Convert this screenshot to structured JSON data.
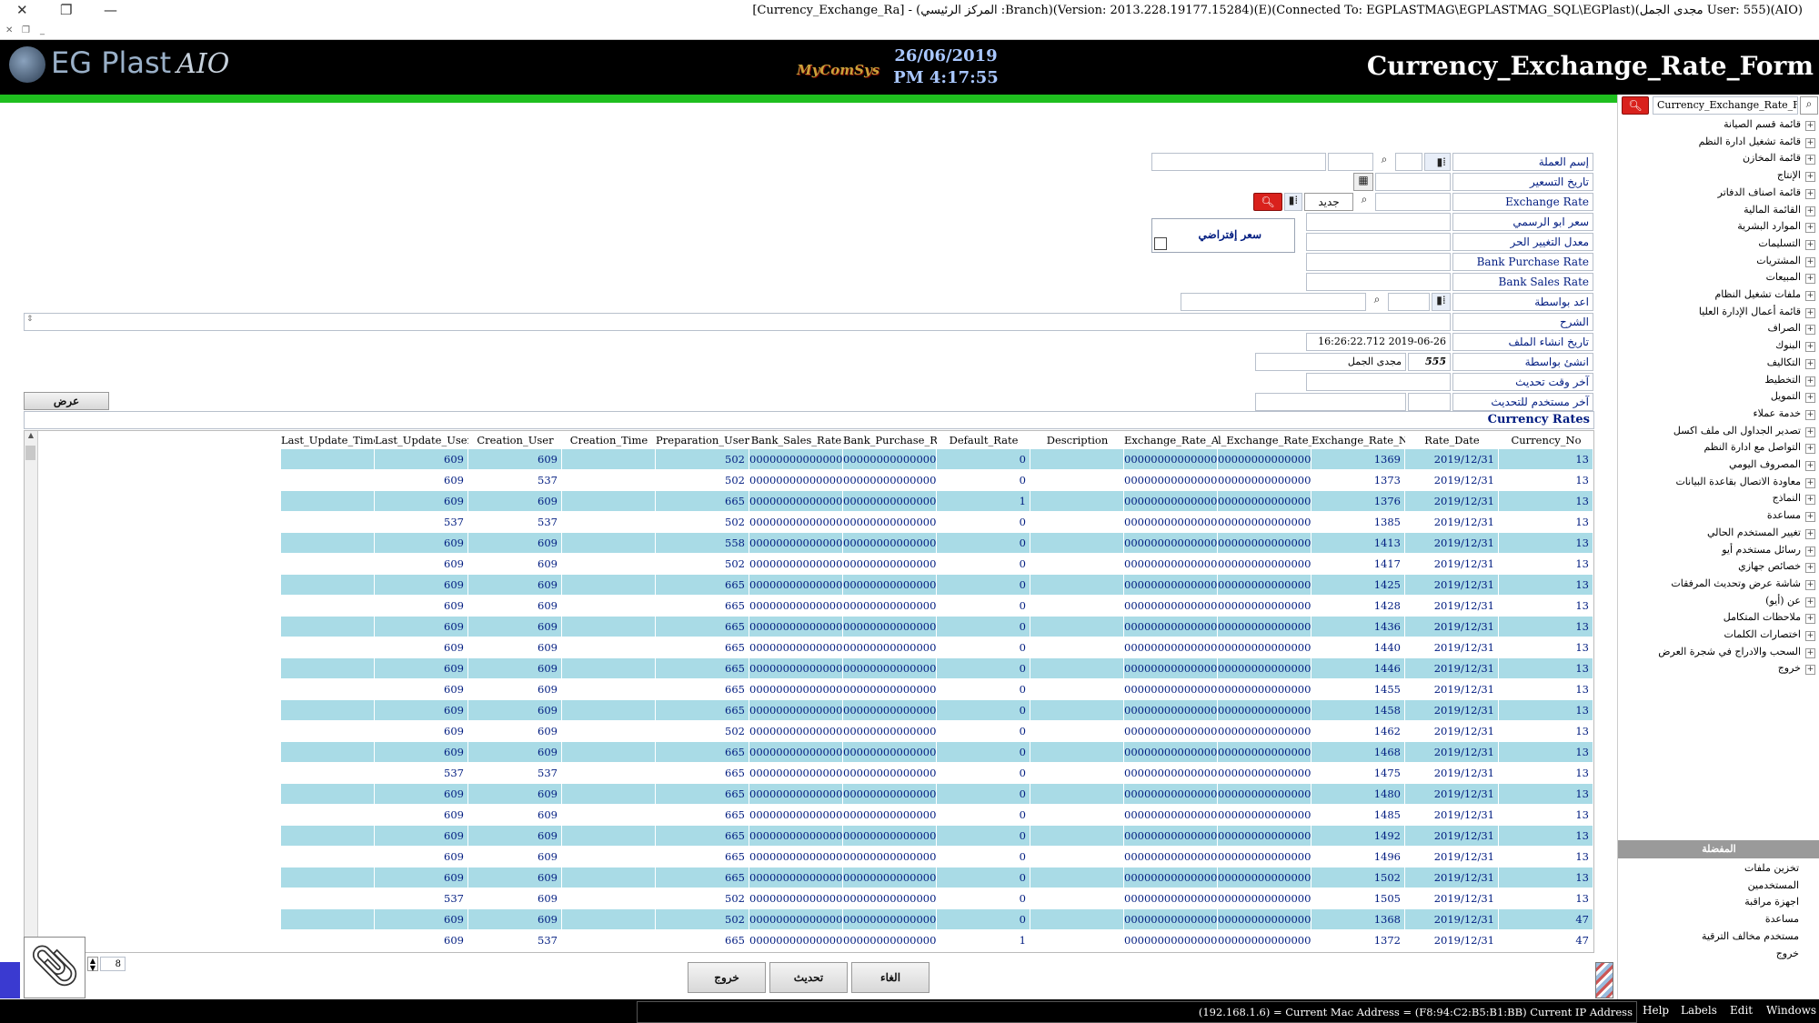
{
  "window": {
    "title": "[Currency_Exchange_Ra] - (المركز الرئيسي :Branch)(Version: 2013.228.19177.15284)(E)(Connected To: EGPLASTMAG\\EGPLASTMAG_SQL\\EGPlast)(مجدى الجمل User: 555)(AIO)"
  },
  "header": {
    "brand": "EG Plast",
    "brand_suffix": "AIO",
    "mycomsys": "MyComSys",
    "date": "26/06/2019",
    "time": "PM 4:17:55",
    "form_title": "Currency_Exchange_Rate_Form"
  },
  "form": {
    "labels": {
      "currency_name": "إسم العملة",
      "price_date": "تاريخ التسعير",
      "exchange_rate": "Exchange Rate",
      "official_price": "سعر ابو الرسمي",
      "free_rate": "معدل التغيير الحر",
      "bank_purchase_rate": "Bank Purchase Rate",
      "bank_sales_rate": "Bank Sales Rate",
      "prepared_by": "اعد بواسطة",
      "description": "الشرح",
      "creation_date": "تاريخ انشاء الملف",
      "created_by": "انشئ بواسطة",
      "last_update_time": "آخر وقت تحديث",
      "last_update_user": "آخر مستخدم للتحديث"
    },
    "new_label": "جديد",
    "default_price_label": "سعر إفتراضي",
    "creation_date_value": "16:26:22.712 2019-06-26",
    "created_by_code": "555",
    "created_by_name": "مجدى الجمل",
    "show_button": "عرض",
    "section_title": "Currency Rates"
  },
  "grid": {
    "columns": [
      "Currency_No",
      "Rate_Date",
      "Exchange_Rate_No",
      "l_Exchange_Rate_A",
      "Exchange_Rate_Am",
      "Description",
      "Default_Rate",
      "Bank_Purchase_Rate",
      "Bank_Sales_Rate",
      "Preparation_User",
      "Creation_Time",
      "Creation_User",
      "Last_Update_User",
      "Last_Update_Time"
    ],
    "rows": [
      [
        "13",
        "2019/12/31",
        "1369",
        "0000000000000000",
        "0000000000000000",
        "",
        "0",
        "0000000000000000",
        "0000000000000000",
        "502",
        "",
        "609",
        "609",
        ""
      ],
      [
        "13",
        "2019/12/31",
        "1373",
        "0000000000000000",
        "0000000000000000",
        "",
        "0",
        "0000000000000000",
        "0000000000000000",
        "502",
        "",
        "537",
        "609",
        ""
      ],
      [
        "13",
        "2019/12/31",
        "1376",
        "0000000000000000",
        "0000000000000000",
        "",
        "1",
        "0000000000000000",
        "0000000000000000",
        "665",
        "",
        "609",
        "609",
        ""
      ],
      [
        "13",
        "2019/12/31",
        "1385",
        "0000000000000000",
        "0000000000000000",
        "",
        "0",
        "0000000000000000",
        "0000000000000000",
        "502",
        "",
        "537",
        "537",
        ""
      ],
      [
        "13",
        "2019/12/31",
        "1413",
        "0000000000000000",
        "0000000000000000",
        "",
        "0",
        "0000000000000000",
        "0000000000000000",
        "558",
        "",
        "609",
        "609",
        ""
      ],
      [
        "13",
        "2019/12/31",
        "1417",
        "0000000000000000",
        "0000000000000000",
        "",
        "0",
        "0000000000000000",
        "0000000000000000",
        "502",
        "",
        "609",
        "609",
        ""
      ],
      [
        "13",
        "2019/12/31",
        "1425",
        "0000000000000000",
        "0000000000000000",
        "",
        "0",
        "0000000000000000",
        "0000000000000000",
        "665",
        "",
        "609",
        "609",
        ""
      ],
      [
        "13",
        "2019/12/31",
        "1428",
        "0000000000000000",
        "0000000000000000",
        "",
        "0",
        "0000000000000000",
        "0000000000000000",
        "665",
        "",
        "609",
        "609",
        ""
      ],
      [
        "13",
        "2019/12/31",
        "1436",
        "0000000000000000",
        "0000000000000000",
        "",
        "0",
        "0000000000000000",
        "0000000000000000",
        "665",
        "",
        "609",
        "609",
        ""
      ],
      [
        "13",
        "2019/12/31",
        "1440",
        "0000000000000000",
        "0000000000000000",
        "",
        "0",
        "0000000000000000",
        "0000000000000000",
        "665",
        "",
        "609",
        "609",
        ""
      ],
      [
        "13",
        "2019/12/31",
        "1446",
        "0000000000000000",
        "0000000000000000",
        "",
        "0",
        "0000000000000000",
        "0000000000000000",
        "665",
        "",
        "609",
        "609",
        ""
      ],
      [
        "13",
        "2019/12/31",
        "1455",
        "0000000000000000",
        "0000000000000000",
        "",
        "0",
        "0000000000000000",
        "0000000000000000",
        "665",
        "",
        "609",
        "609",
        ""
      ],
      [
        "13",
        "2019/12/31",
        "1458",
        "0000000000000000",
        "0000000000000000",
        "",
        "0",
        "0000000000000000",
        "0000000000000000",
        "665",
        "",
        "609",
        "609",
        ""
      ],
      [
        "13",
        "2019/12/31",
        "1462",
        "0000000000000000",
        "0000000000000000",
        "",
        "0",
        "0000000000000000",
        "0000000000000000",
        "502",
        "",
        "609",
        "609",
        ""
      ],
      [
        "13",
        "2019/12/31",
        "1468",
        "0000000000000000",
        "0000000000000000",
        "",
        "0",
        "0000000000000000",
        "0000000000000000",
        "665",
        "",
        "609",
        "609",
        ""
      ],
      [
        "13",
        "2019/12/31",
        "1475",
        "0000000000000000",
        "0000000000000000",
        "",
        "0",
        "0000000000000000",
        "0000000000000000",
        "665",
        "",
        "537",
        "537",
        ""
      ],
      [
        "13",
        "2019/12/31",
        "1480",
        "0000000000000000",
        "0000000000000000",
        "",
        "0",
        "0000000000000000",
        "0000000000000000",
        "665",
        "",
        "609",
        "609",
        ""
      ],
      [
        "13",
        "2019/12/31",
        "1485",
        "0000000000000000",
        "0000000000000000",
        "",
        "0",
        "0000000000000000",
        "0000000000000000",
        "665",
        "",
        "609",
        "609",
        ""
      ],
      [
        "13",
        "2019/12/31",
        "1492",
        "0000000000000000",
        "0000000000000000",
        "",
        "0",
        "0000000000000000",
        "0000000000000000",
        "665",
        "",
        "609",
        "609",
        ""
      ],
      [
        "13",
        "2019/12/31",
        "1496",
        "0000000000000000",
        "0000000000000000",
        "",
        "0",
        "0000000000000000",
        "0000000000000000",
        "665",
        "",
        "609",
        "609",
        ""
      ],
      [
        "13",
        "2019/12/31",
        "1502",
        "0000000000000000",
        "0000000000000000",
        "",
        "0",
        "0000000000000000",
        "0000000000000000",
        "665",
        "",
        "609",
        "609",
        ""
      ],
      [
        "13",
        "2019/12/31",
        "1505",
        "0000000000000000",
        "0000000000000000",
        "",
        "0",
        "0000000000000000",
        "0000000000000000",
        "502",
        "",
        "609",
        "537",
        ""
      ],
      [
        "47",
        "2019/12/31",
        "1368",
        "0000000000000000",
        "0000000000000000",
        "",
        "0",
        "0000000000000000",
        "0000000000000000",
        "502",
        "",
        "609",
        "609",
        ""
      ],
      [
        "47",
        "2019/12/31",
        "1372",
        "0000000000000000",
        "0000000000000000",
        "",
        "1",
        "0000000000000000",
        "0000000000000000",
        "665",
        "",
        "537",
        "609",
        ""
      ]
    ]
  },
  "pager": {
    "value": "8"
  },
  "buttons": {
    "exit": "خروج",
    "refresh": "تحديث",
    "cancel": "الغاء"
  },
  "sidebar": {
    "search_value": "Currency_Exchange_Rate_Form",
    "items": [
      "قائمة قسم الصيانة",
      "قائمة تشغيل ادارة النظم",
      "قائمة المخازن",
      "الإنتاج",
      "قائمة اصناف الدفاتر",
      "القائمة المالية",
      "الموارد البشرية",
      "التسليمات",
      "المشتريات",
      "المبيعات",
      "ملفات تشغيل النظام",
      "قائمة أعمال الإدارة العليا",
      "الصراف",
      "البنوك",
      "التكاليف",
      "التخطيط",
      "التمويل",
      "خدمة عملاء",
      "تصدير الجداول الى ملف اكسل",
      "التواصل مع ادارة النظم",
      "المصروف اليومي",
      "معاودة الاتصال بقاعدة البيانات",
      "النماذج",
      "مساعدة",
      "تغيير المستخدم الحالي",
      "رسائل مستخدم أيو",
      "خصائص جهازي",
      "شاشة عرض وتحديث المرفقات",
      "عن (أيو)",
      "ملاحظات المتكامل",
      "اختصارات الكلمات",
      "السحب والادراج في شجرة العرض",
      "خروج"
    ],
    "favorites_header": "المفضلة",
    "favorites": [
      "تخزين ملفات",
      "المستخدمين",
      "اجهزة مراقبة",
      "مساعدة",
      "مستخدم مخالف الترقية",
      "خروج"
    ]
  },
  "statusbar": {
    "address": "(192.168.1.6) = Current Mac Address = (F8:94:C2:B5:B1:BB) Current IP Address",
    "menu": [
      "Help",
      "Labels",
      "Edit",
      "Windows"
    ]
  }
}
